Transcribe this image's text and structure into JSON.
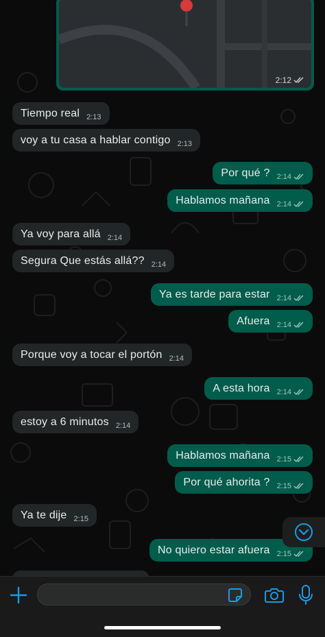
{
  "location_card": {
    "time": "2:12"
  },
  "messages": [
    {
      "dir": "in",
      "text": "Tiempo real",
      "time": "2:13"
    },
    {
      "dir": "in",
      "text": "voy a tu casa a hablar contigo",
      "time": "2:13"
    },
    {
      "dir": "out",
      "text": "Por qué ?",
      "time": "2:14"
    },
    {
      "dir": "out",
      "text": "Hablamos mañana",
      "time": "2:14"
    },
    {
      "dir": "in",
      "text": "Ya voy para allá",
      "time": "2:14"
    },
    {
      "dir": "in",
      "text": "Segura Que estás allá??",
      "time": "2:14"
    },
    {
      "dir": "out",
      "text": "Ya es tarde para estar",
      "time": "2:14"
    },
    {
      "dir": "out",
      "text": "Afuera",
      "time": "2:14"
    },
    {
      "dir": "in",
      "text": "Porque voy a tocar el portón",
      "time": "2:14"
    },
    {
      "dir": "out",
      "text": "A esta hora",
      "time": "2:14"
    },
    {
      "dir": "in",
      "text": "estoy a 6 minutos",
      "time": "2:14"
    },
    {
      "dir": "out",
      "text": "Hablamos mañana",
      "time": "2:15"
    },
    {
      "dir": "out",
      "text": "Por qué ahorita ?",
      "time": "2:15"
    },
    {
      "dir": "in",
      "text": "Ya te dije",
      "time": "2:15"
    },
    {
      "dir": "out",
      "text": "No quiero estar afuera",
      "time": "2:15"
    }
  ],
  "input": {
    "placeholder": ""
  },
  "icons": {
    "attach": "plus-icon",
    "sticker": "sticker-icon",
    "camera": "camera-icon",
    "mic": "microphone-icon",
    "scroll": "chevron-down-icon"
  },
  "colors": {
    "incoming": "#232626",
    "outgoing": "#005c4b",
    "accent": "#1a9be6",
    "background": "#0b0b0b"
  }
}
